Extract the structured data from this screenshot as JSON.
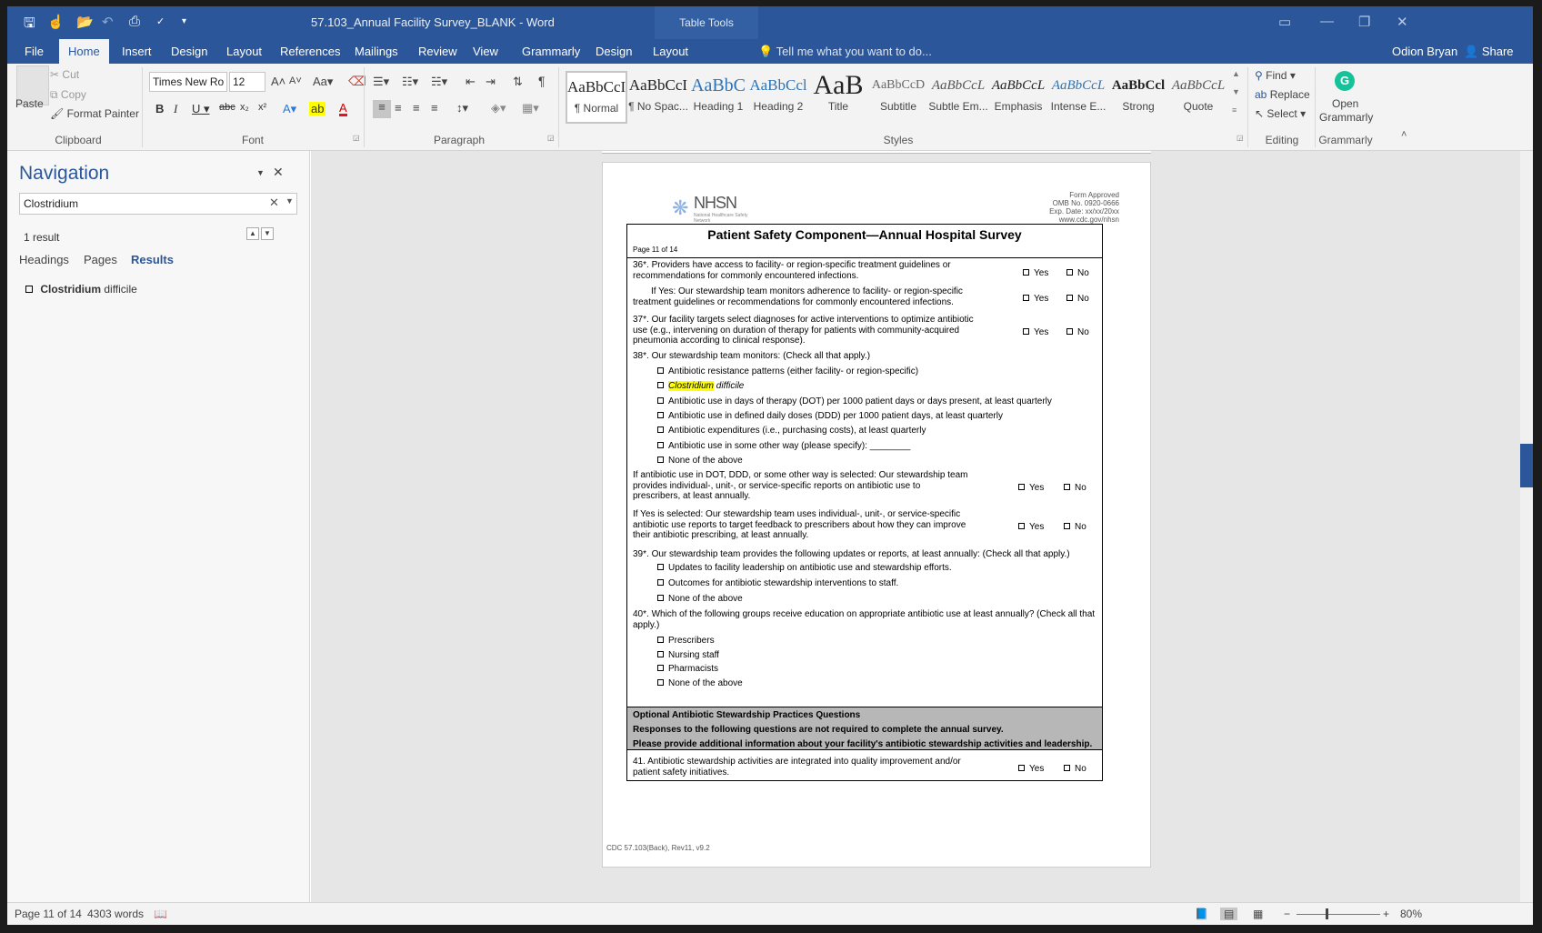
{
  "titlebar": {
    "document_title": "57.103_Annual Facility Survey_BLANK - Word",
    "context_tab": "Table Tools"
  },
  "tabs": {
    "file": "File",
    "home": "Home",
    "insert": "Insert",
    "design": "Design",
    "layout": "Layout",
    "references": "References",
    "mailings": "Mailings",
    "review": "Review",
    "view": "View",
    "grammarly": "Grammarly",
    "table_design": "Design",
    "table_layout": "Layout"
  },
  "tell_me": "Tell me what you want to do...",
  "user_name": "Odion Bryan",
  "share_label": "Share",
  "clipboard": {
    "paste": "Paste",
    "cut": "Cut",
    "copy": "Copy",
    "format_painter": "Format Painter",
    "label": "Clipboard"
  },
  "font": {
    "name": "Times New Ro",
    "size": "12",
    "label": "Font"
  },
  "paragraph": {
    "label": "Paragraph"
  },
  "styles": {
    "label": "Styles",
    "items": [
      {
        "sample": "AaBbCcI",
        "name": "¶ Normal"
      },
      {
        "sample": "AaBbCcI",
        "name": "¶ No Spac..."
      },
      {
        "sample": "AaBbC",
        "name": "Heading 1"
      },
      {
        "sample": "AaBbCcl",
        "name": "Heading 2"
      },
      {
        "sample": "AaB",
        "name": "Title"
      },
      {
        "sample": "AaBbCcD",
        "name": "Subtitle"
      },
      {
        "sample": "AaBbCcL",
        "name": "Subtle Em..."
      },
      {
        "sample": "AaBbCcL",
        "name": "Emphasis"
      },
      {
        "sample": "AaBbCcL",
        "name": "Intense E..."
      },
      {
        "sample": "AaBbCcl",
        "name": "Strong"
      },
      {
        "sample": "AaBbCcL",
        "name": "Quote"
      }
    ]
  },
  "editing": {
    "find": "Find",
    "replace": "Replace",
    "select": "Select",
    "label": "Editing"
  },
  "grammarly_group": {
    "open": "Open",
    "grammarly": "Grammarly",
    "label": "Grammarly"
  },
  "navigation": {
    "title": "Navigation",
    "search_value": "Clostridium",
    "result_count": "1 result",
    "tabs": {
      "headings": "Headings",
      "pages": "Pages",
      "results": "Results"
    },
    "result_match": "Clostridium",
    "result_rest": " difficile"
  },
  "document": {
    "logo_text": "NHSN",
    "logo_sub": "National Healthcare Safety Network",
    "form_approved": [
      "Form Approved",
      "OMB No. 0920-0666",
      "Exp. Date: xx/xx/20xx",
      "www.cdc.gov/nhsn"
    ],
    "survey_title": "Patient Safety Component—Annual Hospital Survey",
    "page_of": "Page 11 of 14",
    "yes": "Yes",
    "no": "No",
    "q36": [
      "36*. Providers have access to facility- or region-specific treatment guidelines or",
      "recommendations for commonly encountered infections."
    ],
    "q36a": [
      "If Yes: Our stewardship team monitors adherence to facility- or region-specific",
      "treatment guidelines or recommendations for commonly encountered infections."
    ],
    "q37": [
      "37*. Our facility targets select diagnoses for active interventions to optimize antibiotic",
      "use (e.g., intervening on duration of therapy for patients with community-acquired",
      "pneumonia according to clinical response)."
    ],
    "q38": "38*. Our stewardship team monitors: (Check all that apply.)",
    "q38_opts": {
      "o1": "Antibiotic resistance patterns (either facility- or region-specific)",
      "o2_match": "Clostridium",
      "o2_rest": " difficile",
      "o3": "Antibiotic use in days of therapy (DOT) per 1000 patient days or days present, at least quarterly",
      "o4": "Antibiotic use in defined daily doses (DDD) per 1000 patient days, at least quarterly",
      "o5": "Antibiotic expenditures (i.e., purchasing costs), at least quarterly",
      "o6": "Antibiotic use in some other way (please specify): ________",
      "o7": "None of the above"
    },
    "q38a": [
      "If antibiotic use in DOT, DDD, or some other way is selected: Our stewardship team",
      "provides individual-, unit-, or service-specific reports on antibiotic use to",
      "prescribers, at least annually."
    ],
    "q38b": [
      "If Yes is selected: Our stewardship team uses individual-, unit-, or service-specific",
      "antibiotic use reports to target feedback to prescribers about how they can improve",
      "their antibiotic prescribing, at least annually."
    ],
    "q39": "39*. Our stewardship team provides the following updates or reports, at least annually: (Check all that apply.)",
    "q39_opts": {
      "o1": "Updates to facility leadership on antibiotic use and stewardship efforts.",
      "o2": "Outcomes for antibiotic stewardship interventions to staff.",
      "o3": "None of the above"
    },
    "q40": [
      "40*. Which of the following groups receive education on appropriate antibiotic use at least annually? (Check all that",
      "apply.)"
    ],
    "q40_opts": {
      "o1": "Prescribers",
      "o2": "Nursing staff",
      "o3": "Pharmacists",
      "o4": "None of the above"
    },
    "optional_title": "Optional Antibiotic Stewardship Practices Questions",
    "optional_line2": "Responses to the following questions are not required to complete the annual survey.",
    "optional_line3": "Please provide additional information about your facility's antibiotic stewardship activities and leadership.",
    "q41": [
      "41. Antibiotic stewardship activities are integrated into quality improvement and/or",
      "patient safety initiatives."
    ],
    "footer": "CDC 57.103(Back), Rev11, v9.2"
  },
  "status": {
    "page": "Page 11 of 14",
    "words": "4303 words",
    "zoom": "80%"
  },
  "colors": {
    "word_blue": "#2b579a",
    "highlight": "#ffff00",
    "band_gray": "#b7b7b7"
  }
}
